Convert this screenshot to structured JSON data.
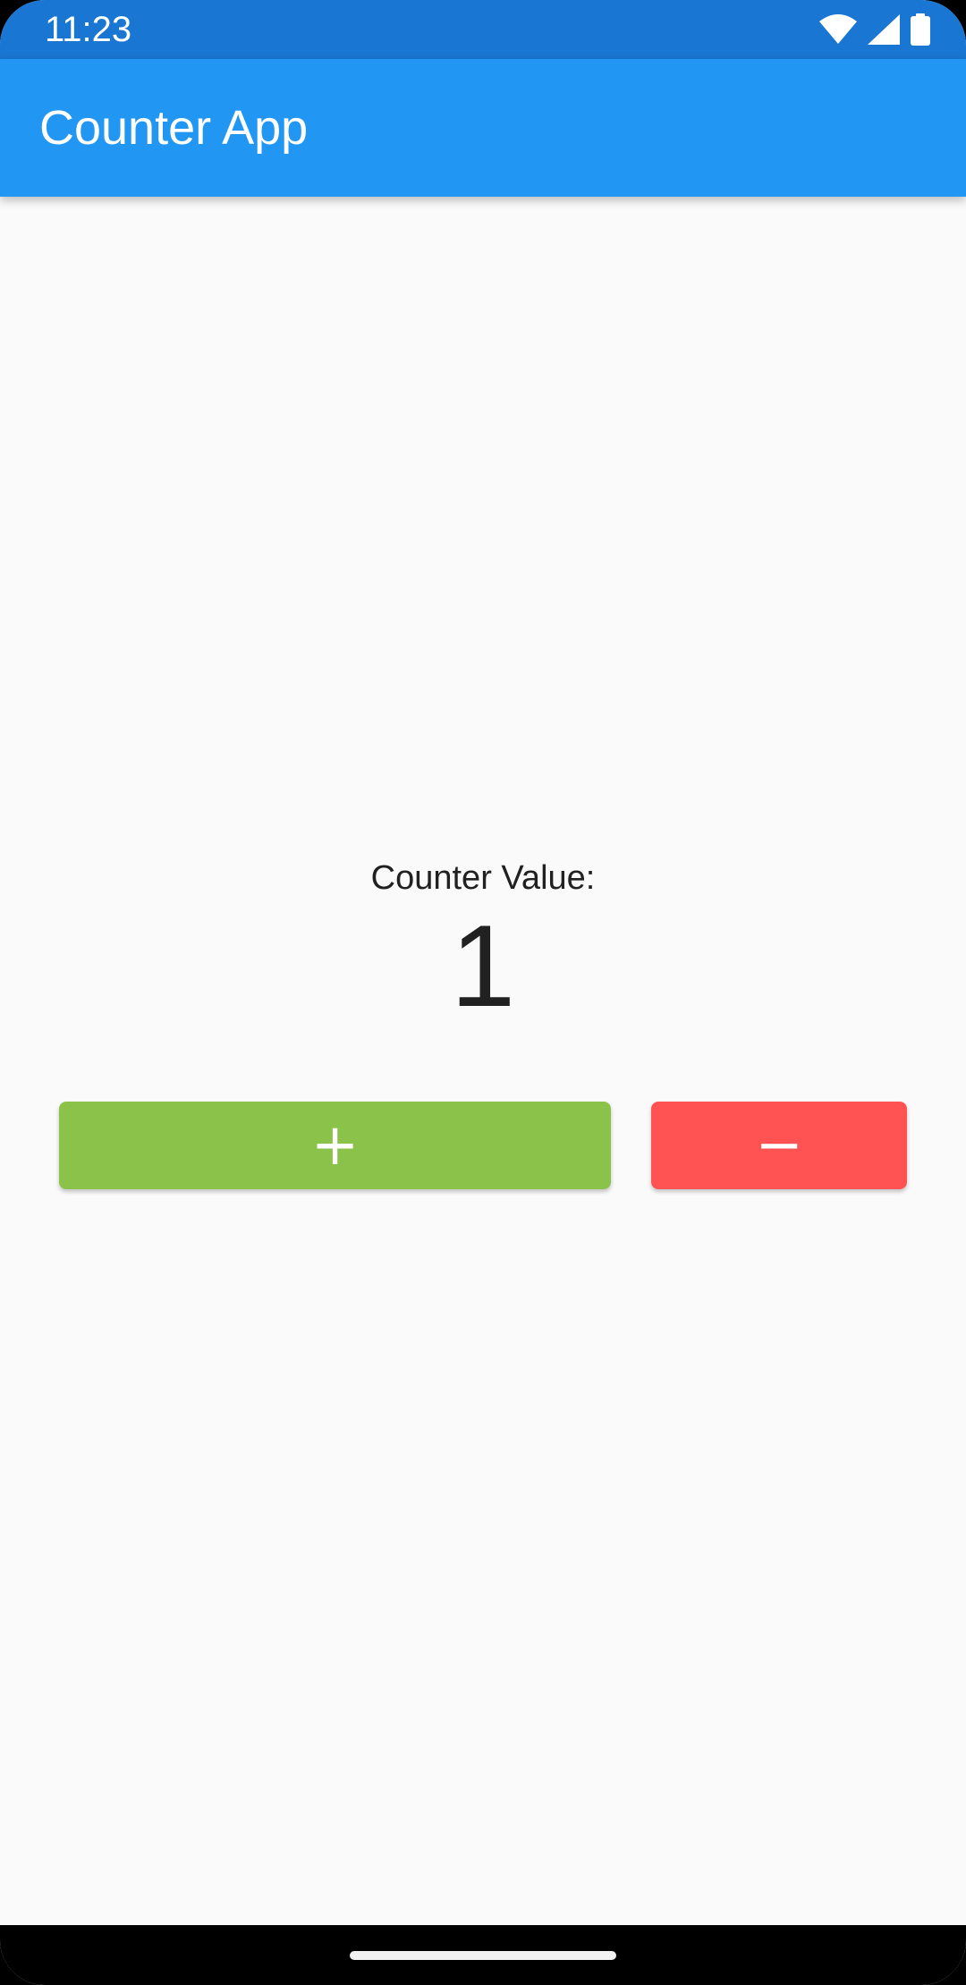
{
  "status_bar": {
    "time": "11:23",
    "icons": [
      "wifi-icon",
      "cellular-signal-icon",
      "battery-icon"
    ]
  },
  "app_bar": {
    "title": "Counter App",
    "color": "#2196f3",
    "status_color": "#1976d2"
  },
  "counter": {
    "label": "Counter Value:",
    "value": "1"
  },
  "buttons": {
    "increment": {
      "label": "+",
      "color": "#8bc34a"
    },
    "decrement": {
      "label": "−",
      "color": "#ff5252"
    }
  },
  "nav_bar": {
    "indicator": "home-indicator"
  }
}
